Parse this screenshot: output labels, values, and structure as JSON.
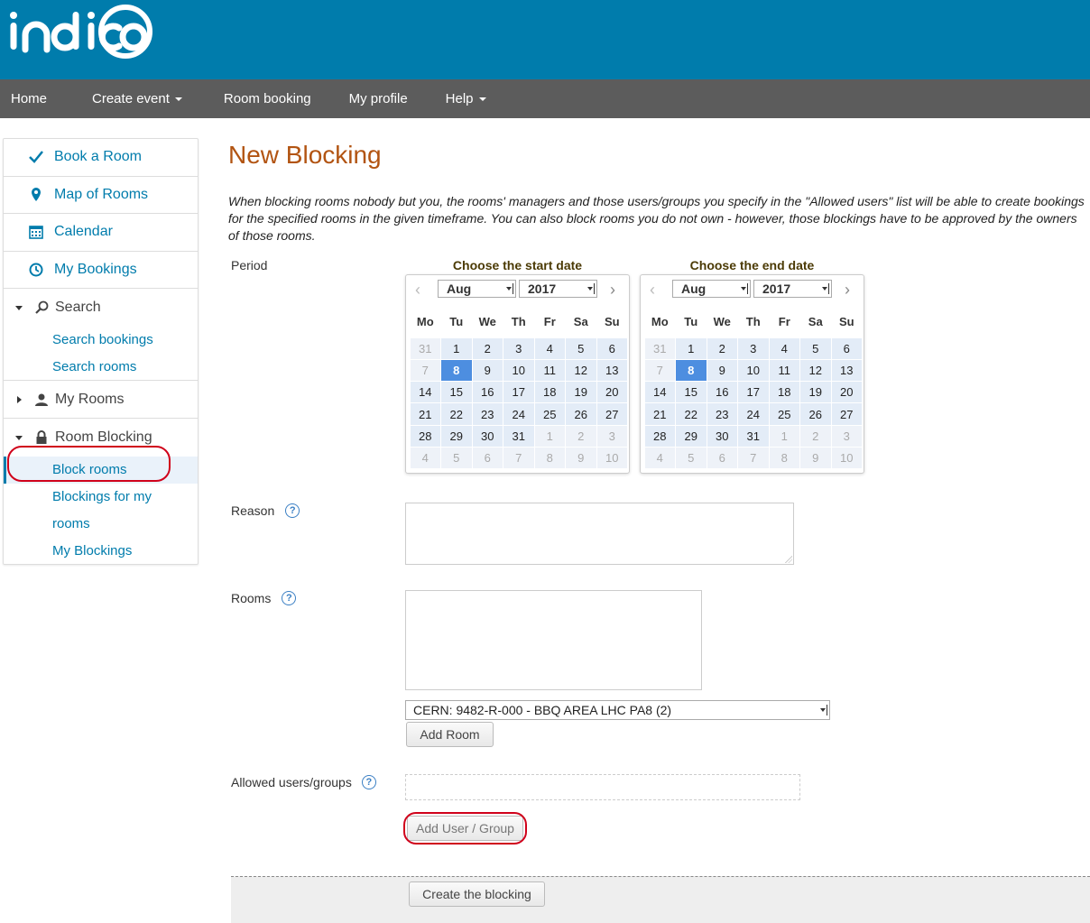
{
  "header": {
    "logo_text": "indico"
  },
  "nav": {
    "items": [
      {
        "label": "Home",
        "caret": false
      },
      {
        "label": "Create event",
        "caret": true
      },
      {
        "label": "Room booking",
        "caret": false
      },
      {
        "label": "My profile",
        "caret": false
      },
      {
        "label": "Help",
        "caret": true
      }
    ]
  },
  "sidebar": {
    "main_items": [
      {
        "label": "Book a Room",
        "icon": "check-icon"
      },
      {
        "label": "Map of Rooms",
        "icon": "map-marker-icon"
      },
      {
        "label": "Calendar",
        "icon": "calendar-icon"
      },
      {
        "label": "My Bookings",
        "icon": "clock-icon"
      }
    ],
    "search": {
      "label": "Search",
      "sub": [
        "Search bookings",
        "Search rooms"
      ]
    },
    "my_rooms": {
      "label": "My Rooms"
    },
    "room_blocking": {
      "label": "Room Blocking",
      "sub": [
        "Block rooms",
        "Blockings for my",
        "rooms",
        "My Blockings"
      ]
    }
  },
  "main": {
    "title": "New Blocking",
    "intro": "When blocking rooms nobody but you, the rooms' managers and those users/groups you specify in the \"Allowed users\" list will be able to create bookings for the specified rooms in the given timeframe. You can also block rooms you do not own - however, those blockings have to be approved by the owners of those rooms.",
    "period_label": "Period",
    "start_title": "Choose the start date",
    "end_title": "Choose the end date",
    "calendar": {
      "month": "Aug",
      "year": "2017",
      "dow": [
        "Mo",
        "Tu",
        "We",
        "Th",
        "Fr",
        "Sa",
        "Su"
      ],
      "today": "8",
      "days": [
        [
          "31",
          "1",
          "2",
          "3",
          "4",
          "5",
          "6"
        ],
        [
          "7",
          "8",
          "9",
          "10",
          "11",
          "12",
          "13"
        ],
        [
          "14",
          "15",
          "16",
          "17",
          "18",
          "19",
          "20"
        ],
        [
          "21",
          "22",
          "23",
          "24",
          "25",
          "26",
          "27"
        ],
        [
          "28",
          "29",
          "30",
          "31",
          "1",
          "2",
          "3"
        ],
        [
          "4",
          "5",
          "6",
          "7",
          "8",
          "9",
          "10"
        ]
      ]
    },
    "reason_label": "Reason",
    "rooms_label": "Rooms",
    "room_select": "CERN: 9482-R-000 - BBQ AREA LHC PA8 (2)",
    "add_room": "Add Room",
    "allowed_label": "Allowed users/groups",
    "add_user": "Add User / Group",
    "create": "Create the blocking"
  },
  "colors": {
    "brand": "#007cac",
    "title": "#b25412",
    "highlight": "#d0021b"
  }
}
